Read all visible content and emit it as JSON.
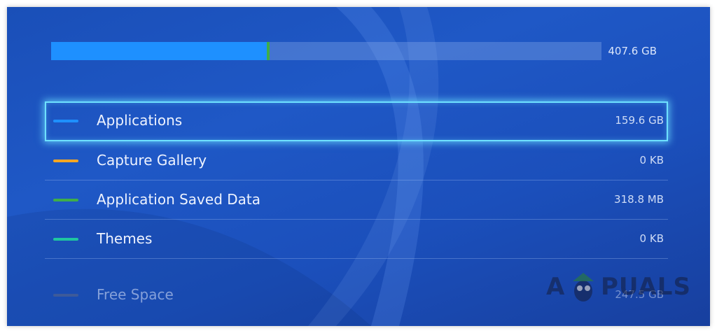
{
  "storage": {
    "total_label": "407.6 GB",
    "used_fraction_applications": 0.392,
    "used_fraction_saved_data": 0.001
  },
  "categories": [
    {
      "label": "Applications",
      "size": "159.6 GB",
      "color": "#1e90ff",
      "focused": true
    },
    {
      "label": "Capture Gallery",
      "size": "0 KB",
      "color": "#f5a623",
      "focused": false
    },
    {
      "label": "Application Saved Data",
      "size": "318.8 MB",
      "color": "#3fae49",
      "focused": false
    },
    {
      "label": "Themes",
      "size": "0 KB",
      "color": "#1fc6a0",
      "focused": false
    }
  ],
  "free_space": {
    "label": "Free Space",
    "size": "247.5 GB",
    "color": "#3d5a9a"
  },
  "watermark": {
    "text_a": "A",
    "text_rest": "PUALS"
  },
  "colors": {
    "background": "#1f58c6",
    "focus_border": "#6ee0ff"
  }
}
